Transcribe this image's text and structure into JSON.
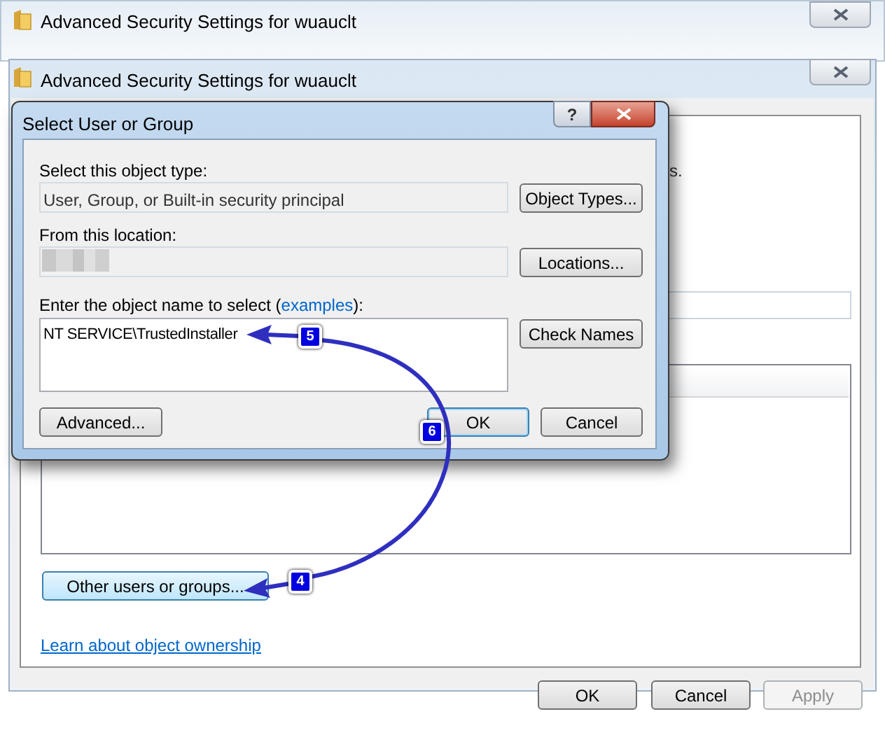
{
  "back_window": {
    "title": "Advanced Security Settings for wuauclt"
  },
  "window": {
    "title": "Advanced Security Settings for wuauclt",
    "fragment": "s.",
    "other_users_button": {
      "label": "Other users or groups...",
      "hover": true
    },
    "link": "Learn about object ownership",
    "buttons": [
      {
        "label": "OK",
        "disabled": false
      },
      {
        "label": "Cancel",
        "disabled": false
      },
      {
        "label": "Apply",
        "disabled": true
      }
    ]
  },
  "dialog": {
    "title": "Select User or Group",
    "help": "?",
    "object_type_label": "Select this object type:",
    "object_type_value": "User, Group, or Built-in security principal",
    "object_types_button": "Object Types...",
    "location_label": "From this location:",
    "locations_button": "Locations...",
    "name_label": "Enter the object name to select (",
    "name_label_link": "examples",
    "name_label_end": "):",
    "name_value": "NT SERVICE\\TrustedInstaller",
    "check_names_button": "Check Names",
    "buttons": [
      {
        "label": "Advanced...",
        "default": false
      },
      {
        "label": "OK",
        "default": true
      },
      {
        "label": "Cancel",
        "default": false
      }
    ]
  },
  "annotations": [
    {
      "number": "5"
    },
    {
      "number": "6"
    },
    {
      "number": "4"
    }
  ]
}
